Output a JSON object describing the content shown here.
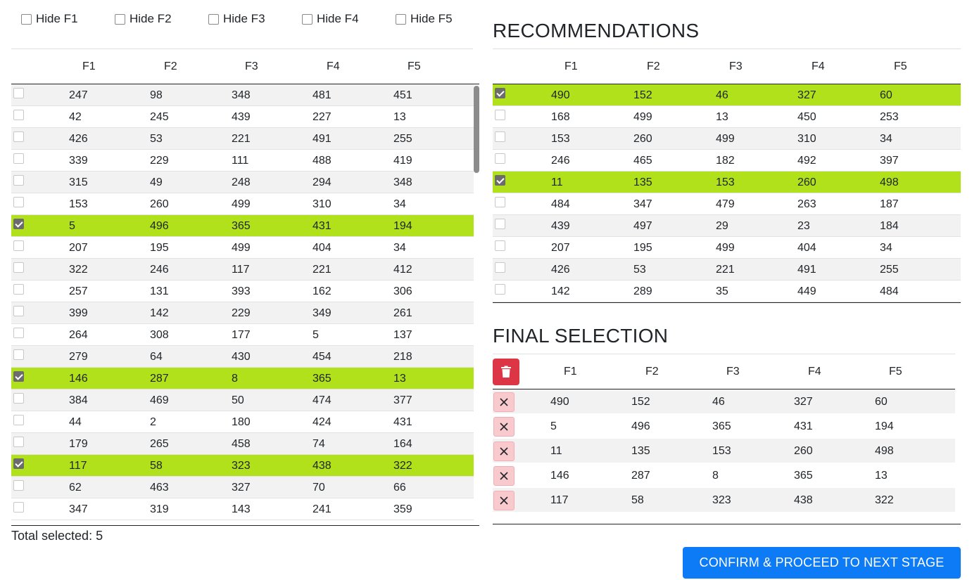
{
  "hide_toggles": [
    {
      "label": "Hide F1",
      "checked": false
    },
    {
      "label": "Hide F2",
      "checked": false
    },
    {
      "label": "Hide F3",
      "checked": false
    },
    {
      "label": "Hide F4",
      "checked": false
    },
    {
      "label": "Hide F5",
      "checked": false
    }
  ],
  "columns": [
    "F1",
    "F2",
    "F3",
    "F4",
    "F5"
  ],
  "main_table": {
    "rows": [
      {
        "checked": false,
        "values": [
          "247",
          "98",
          "348",
          "481",
          "451"
        ]
      },
      {
        "checked": false,
        "values": [
          "42",
          "245",
          "439",
          "227",
          "13"
        ]
      },
      {
        "checked": false,
        "values": [
          "426",
          "53",
          "221",
          "491",
          "255"
        ]
      },
      {
        "checked": false,
        "values": [
          "339",
          "229",
          "111",
          "488",
          "419"
        ]
      },
      {
        "checked": false,
        "values": [
          "315",
          "49",
          "248",
          "294",
          "348"
        ]
      },
      {
        "checked": false,
        "values": [
          "153",
          "260",
          "499",
          "310",
          "34"
        ]
      },
      {
        "checked": true,
        "values": [
          "5",
          "496",
          "365",
          "431",
          "194"
        ]
      },
      {
        "checked": false,
        "values": [
          "207",
          "195",
          "499",
          "404",
          "34"
        ]
      },
      {
        "checked": false,
        "values": [
          "322",
          "246",
          "117",
          "221",
          "412"
        ]
      },
      {
        "checked": false,
        "values": [
          "257",
          "131",
          "393",
          "162",
          "306"
        ]
      },
      {
        "checked": false,
        "values": [
          "399",
          "142",
          "229",
          "349",
          "261"
        ]
      },
      {
        "checked": false,
        "values": [
          "264",
          "308",
          "177",
          "5",
          "137"
        ]
      },
      {
        "checked": false,
        "values": [
          "279",
          "64",
          "430",
          "454",
          "218"
        ]
      },
      {
        "checked": true,
        "values": [
          "146",
          "287",
          "8",
          "365",
          "13"
        ]
      },
      {
        "checked": false,
        "values": [
          "384",
          "469",
          "50",
          "474",
          "377"
        ]
      },
      {
        "checked": false,
        "values": [
          "44",
          "2",
          "180",
          "424",
          "431"
        ]
      },
      {
        "checked": false,
        "values": [
          "179",
          "265",
          "458",
          "74",
          "164"
        ]
      },
      {
        "checked": true,
        "values": [
          "117",
          "58",
          "323",
          "438",
          "322"
        ]
      },
      {
        "checked": false,
        "values": [
          "62",
          "463",
          "327",
          "70",
          "66"
        ]
      },
      {
        "checked": false,
        "values": [
          "347",
          "319",
          "143",
          "241",
          "359"
        ]
      }
    ],
    "total_label": "Total selected: 5"
  },
  "recommendations": {
    "title": "RECOMMENDATIONS",
    "rows": [
      {
        "checked": true,
        "values": [
          "490",
          "152",
          "46",
          "327",
          "60"
        ]
      },
      {
        "checked": false,
        "values": [
          "168",
          "499",
          "13",
          "450",
          "253"
        ]
      },
      {
        "checked": false,
        "values": [
          "153",
          "260",
          "499",
          "310",
          "34"
        ]
      },
      {
        "checked": false,
        "values": [
          "246",
          "465",
          "182",
          "492",
          "397"
        ]
      },
      {
        "checked": true,
        "values": [
          "11",
          "135",
          "153",
          "260",
          "498"
        ]
      },
      {
        "checked": false,
        "values": [
          "484",
          "347",
          "479",
          "263",
          "187"
        ]
      },
      {
        "checked": false,
        "values": [
          "439",
          "497",
          "29",
          "23",
          "184"
        ]
      },
      {
        "checked": false,
        "values": [
          "207",
          "195",
          "499",
          "404",
          "34"
        ]
      },
      {
        "checked": false,
        "values": [
          "426",
          "53",
          "221",
          "491",
          "255"
        ]
      },
      {
        "checked": false,
        "values": [
          "142",
          "289",
          "35",
          "449",
          "484"
        ]
      }
    ]
  },
  "final_selection": {
    "title": "FINAL SELECTION",
    "rows": [
      {
        "values": [
          "490",
          "152",
          "46",
          "327",
          "60"
        ]
      },
      {
        "values": [
          "5",
          "496",
          "365",
          "431",
          "194"
        ]
      },
      {
        "values": [
          "11",
          "135",
          "153",
          "260",
          "498"
        ]
      },
      {
        "values": [
          "146",
          "287",
          "8",
          "365",
          "13"
        ]
      },
      {
        "values": [
          "117",
          "58",
          "323",
          "438",
          "322"
        ]
      }
    ]
  },
  "confirm_label": "CONFIRM & PROCEED TO NEXT STAGE",
  "colors": {
    "selected_row": "#b0e11b",
    "alt_row": "#f2f2f2",
    "danger": "#dc3545",
    "primary": "#0d7bf5"
  }
}
